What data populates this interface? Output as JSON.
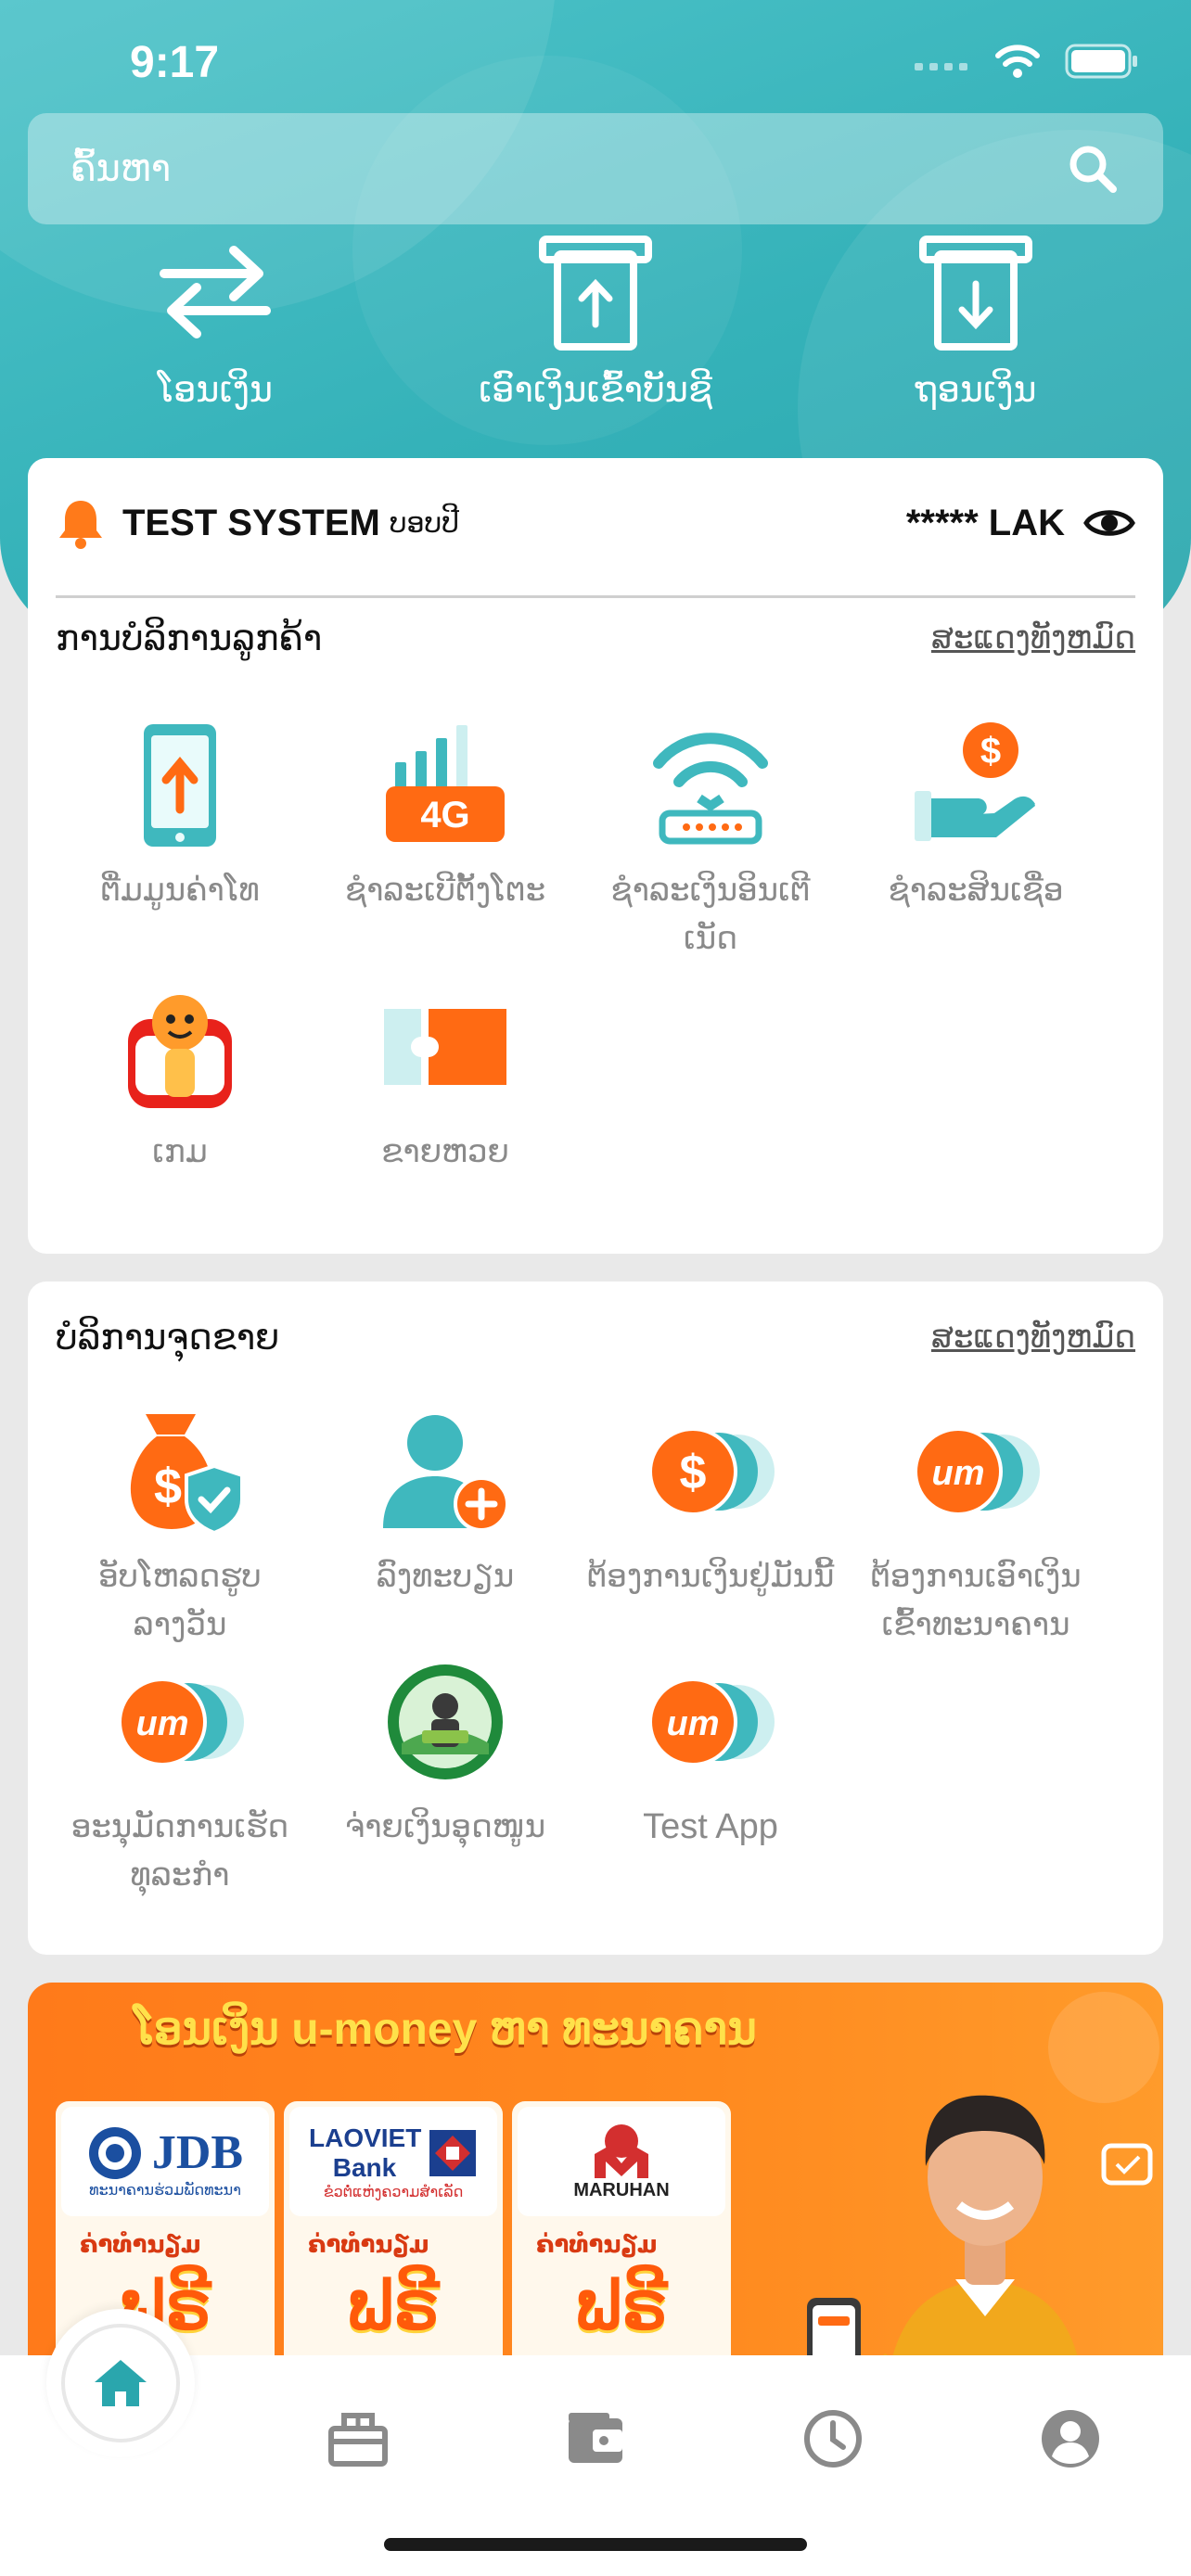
{
  "status_bar": {
    "time": "9:17"
  },
  "search": {
    "placeholder": "ຄົ້ນຫາ"
  },
  "quick_actions": [
    {
      "label": "ໂອນເງິນ",
      "icon": "transfer-arrows-icon"
    },
    {
      "label": "ເອົາເງິນເຂົ້າບັນຊີ",
      "icon": "deposit-icon"
    },
    {
      "label": "ຖອນເງິນ",
      "icon": "withdraw-icon"
    }
  ],
  "account": {
    "name": "TEST SYSTEM",
    "suffix": "ບອບປີ",
    "balance": "***** LAK"
  },
  "customer_services": {
    "title": "ການບໍລິການລູກຄ້າ",
    "show_all": "ສະແດງທັງຫມົດ",
    "items": [
      {
        "label": "ຕື່ມມູນຄ່າໂທ",
        "icon": "phone-topup-icon"
      },
      {
        "label": "ຊຳລະເບີຕັ້ງໂຕະ",
        "icon": "4g-signal-icon"
      },
      {
        "label": "ຊຳລະເງິນອິນເຕີເນັດ",
        "icon": "wifi-router-icon"
      },
      {
        "label": "ຊຳລະສິນເຊື່ອ",
        "icon": "hand-coin-icon"
      },
      {
        "label": "ເກມ",
        "icon": "game-mascot-icon"
      },
      {
        "label": "ຂາຍຫວຍ",
        "icon": "lottery-ticket-icon"
      }
    ]
  },
  "agent_services": {
    "title": "ບໍລິການຈຸດຂາຍ",
    "show_all": "ສະແດງທັງຫມົດ",
    "items": [
      {
        "label": "ອັບໂຫລດຮູບລາງວັນ",
        "icon": "money-bag-shield-icon"
      },
      {
        "label": "ລົງທະບຽນ",
        "icon": "user-add-icon"
      },
      {
        "label": "ຕ້ອງການເງິນຢູ່ມັນນີ້",
        "icon": "dollar-coins-icon"
      },
      {
        "label": "ຕ້ອງການເອົາເງິນເຂົ້າທະນາຄານ",
        "icon": "umoney-coins-icon"
      },
      {
        "label": "ອະນຸມັດການເຮັດທຸລະກຳ",
        "icon": "umoney-coins-icon"
      },
      {
        "label": "ຈ່າຍເງິນອຸດໜູນ",
        "icon": "subsidy-seal-icon"
      },
      {
        "label": "Test App",
        "icon": "umoney-coins-icon"
      }
    ]
  },
  "banner": {
    "headline": "ໂອນເງິນ u-money ຫາ ທະນາຄານ",
    "fee_label": "ຄ່າທຳນຽມ",
    "free_label": "ຟຣີ",
    "banks": [
      {
        "name": "JDB",
        "tagline": "ທະນາຄານຮ່ວມພັດທະນາ"
      },
      {
        "name": "LAOVIET Bank",
        "tagline": "ຂໍວຕໍ່ແຫ່ງຄວາມສໍາເລັດ"
      },
      {
        "name": "MARUHAN",
        "tagline": ""
      }
    ]
  },
  "tab_bar": {
    "items": [
      "home-icon",
      "gift-icon",
      "wallet-icon",
      "history-clock-icon",
      "profile-icon"
    ]
  },
  "colors": {
    "teal": "#35b2b9",
    "orange": "#ff6a13",
    "text_gray": "#8a8a8a"
  }
}
